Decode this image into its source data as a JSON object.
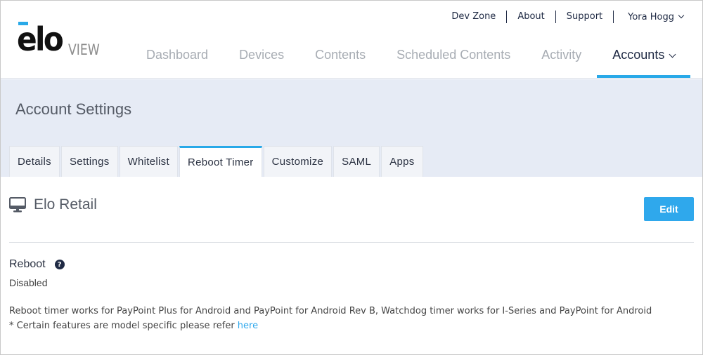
{
  "brand": {
    "logo_text": "elo",
    "logo_sub": "VIEW",
    "accent_color": "#29a9e8"
  },
  "util_nav": {
    "items": [
      "Dev Zone",
      "About",
      "Support"
    ],
    "user_name": "Yora Hogg"
  },
  "main_nav": {
    "items": [
      {
        "label": "Dashboard",
        "active": false
      },
      {
        "label": "Devices",
        "active": false
      },
      {
        "label": "Contents",
        "active": false
      },
      {
        "label": "Scheduled Contents",
        "active": false
      },
      {
        "label": "Activity",
        "active": false
      },
      {
        "label": "Accounts",
        "active": true
      }
    ]
  },
  "page": {
    "title": "Account Settings"
  },
  "tabs": [
    {
      "label": "Details",
      "active": false
    },
    {
      "label": "Settings",
      "active": false
    },
    {
      "label": "Whitelist",
      "active": false
    },
    {
      "label": "Reboot Timer",
      "active": true
    },
    {
      "label": "Customize",
      "active": false
    },
    {
      "label": "SAML",
      "active": false
    },
    {
      "label": "Apps",
      "active": false
    }
  ],
  "content": {
    "device_name": "Elo Retail",
    "edit_label": "Edit",
    "reboot_label": "Reboot",
    "reboot_status": "Disabled",
    "note_line1": "Reboot timer works for PayPoint Plus for Android and PayPoint for Android Rev B, Watchdog timer works for I-Series and PayPoint for Android",
    "note_line2_prefix": "* Certain features are model specific please refer ",
    "note_link": "here"
  },
  "icons": {
    "device": "monitor-icon",
    "help": "question-circle-icon",
    "dropdown": "chevron-down-icon"
  }
}
